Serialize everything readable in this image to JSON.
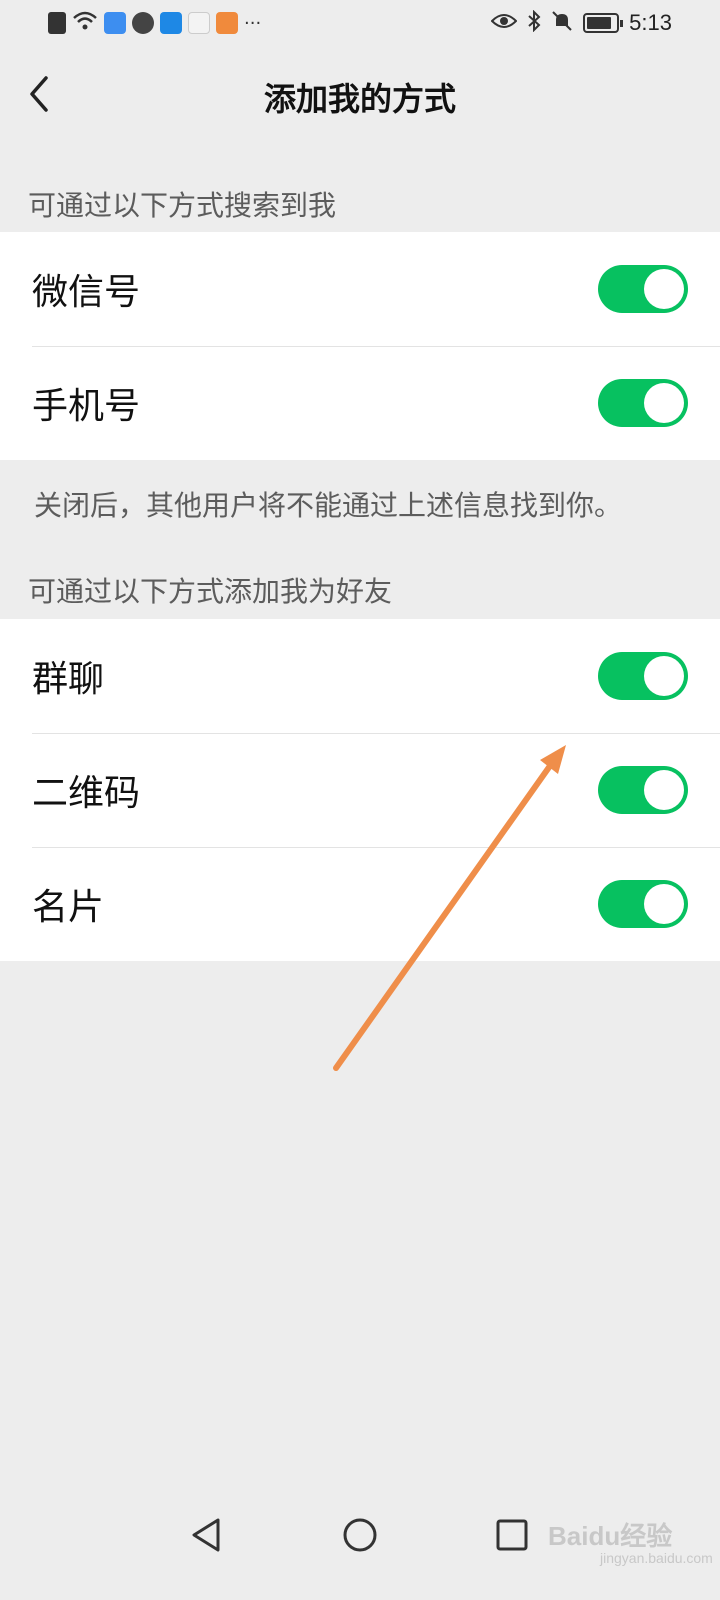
{
  "status_bar": {
    "time": "5:13",
    "left_icons": [
      "alert-icon",
      "wifi-icon",
      "cloud-app-icon",
      "browser-icon",
      "weather-app-icon",
      "bird-app-icon",
      "video-app-icon",
      "more-icon"
    ],
    "right_icons": [
      "eye-icon",
      "bluetooth-icon",
      "mute-bell-icon",
      "battery-icon"
    ],
    "more_label": "···"
  },
  "header": {
    "title": "添加我的方式"
  },
  "search_section": {
    "header": "可通过以下方式搜索到我",
    "items": [
      {
        "label": "微信号",
        "enabled": true
      },
      {
        "label": "手机号",
        "enabled": true
      }
    ],
    "hint": "关闭后，其他用户将不能通过上述信息找到你。"
  },
  "add_section": {
    "header": "可通过以下方式添加我为好友",
    "items": [
      {
        "label": "群聊",
        "enabled": true
      },
      {
        "label": "二维码",
        "enabled": true
      },
      {
        "label": "名片",
        "enabled": true
      }
    ]
  },
  "colors": {
    "toggle_on": "#07c160",
    "background": "#ededed",
    "annotation_arrow": "#ef8e4a"
  },
  "system_nav": {
    "buttons": [
      "back-triangle-icon",
      "home-circle-icon",
      "recents-square-icon"
    ]
  },
  "watermark": {
    "text": "Baidu经验",
    "sub": "jingyan.baidu.com"
  }
}
